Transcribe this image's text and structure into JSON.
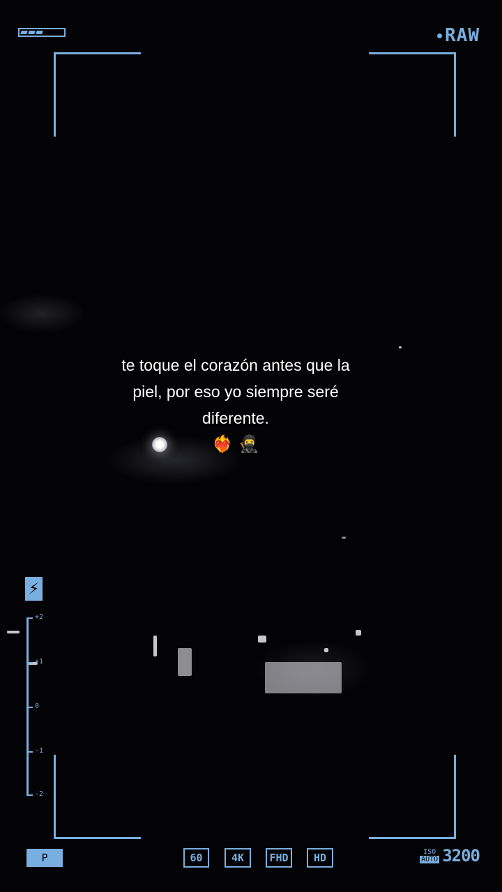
{
  "status": {
    "battery_icon": "battery-icon",
    "raw_label": "RAW",
    "accent_color": "#79aee0"
  },
  "caption": {
    "lines": [
      "te toque el corazón antes que la",
      "piel, por eso yo siempre seré",
      "diferente."
    ],
    "emojis": [
      "❤️‍🔥",
      "🥷"
    ]
  },
  "sidebar": {
    "flash_icon": "flash-icon",
    "flash_glyph": "⚡",
    "ev_labels": [
      "+2",
      "+1",
      "0",
      "-1",
      "-2"
    ]
  },
  "bottom_bar": {
    "mode": "P",
    "formats": [
      "60",
      "4K",
      "FHD",
      "HD"
    ],
    "iso_label": "ISO",
    "iso_mode": "AUTO",
    "iso_value": "3200"
  }
}
